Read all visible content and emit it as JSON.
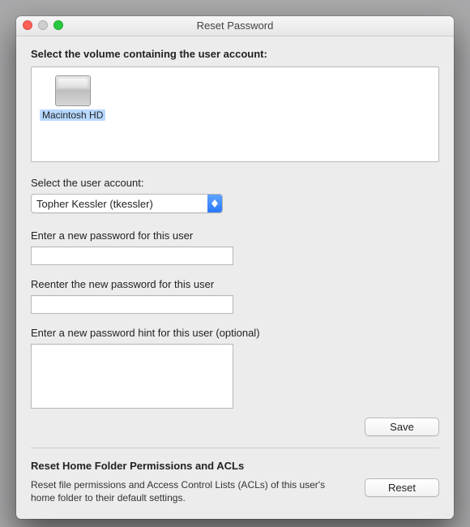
{
  "window": {
    "title": "Reset Password"
  },
  "volume_section": {
    "heading": "Select the volume containing the user account:",
    "items": [
      {
        "name": "Macintosh HD",
        "selected": true
      }
    ]
  },
  "user_section": {
    "label": "Select the user account:",
    "selected": "Topher Kessler (tkessler)"
  },
  "password_section": {
    "new_label": "Enter a new password for this user",
    "new_value": "",
    "confirm_label": "Reenter the new password for this user",
    "confirm_value": "",
    "hint_label": "Enter a new password hint for this user (optional)",
    "hint_value": "",
    "save_label": "Save"
  },
  "acl_section": {
    "heading": "Reset Home Folder Permissions and ACLs",
    "description": "Reset file permissions and Access Control Lists (ACLs) of this user's home folder to their default settings.",
    "reset_label": "Reset"
  }
}
